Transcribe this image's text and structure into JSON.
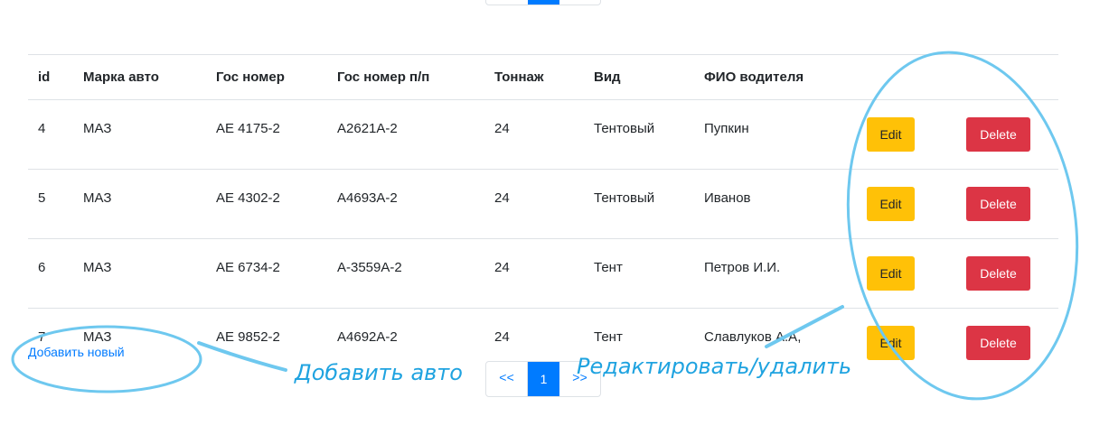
{
  "table": {
    "headers": [
      "id",
      "Марка авто",
      "Гос номер",
      "Гос номер п/п",
      "Тоннаж",
      "Вид",
      "ФИО водителя"
    ],
    "rows": [
      {
        "id": "4",
        "brand": "МАЗ",
        "plate": "АЕ 4175-2",
        "trailer_plate": "А2621А-2",
        "tonnage": "24",
        "type": "Тентовый",
        "driver": "Пупкин"
      },
      {
        "id": "5",
        "brand": "МАЗ",
        "plate": "АЕ 4302-2",
        "trailer_plate": "А4693А-2",
        "tonnage": "24",
        "type": "Тентовый",
        "driver": "Иванов"
      },
      {
        "id": "6",
        "brand": "МАЗ",
        "plate": "АЕ 6734-2",
        "trailer_plate": "А-3559А-2",
        "tonnage": "24",
        "type": "Тент",
        "driver": "Петров И.И."
      },
      {
        "id": "7",
        "brand": "МАЗ",
        "plate": "АЕ 9852-2",
        "trailer_plate": "А4692А-2",
        "tonnage": "24",
        "type": "Тент",
        "driver": "Славлуков А.А,"
      }
    ],
    "edit_label": "Edit",
    "delete_label": "Delete"
  },
  "add_link": "Добавить новый",
  "pagination": {
    "prev": "<<",
    "current": "1",
    "next": ">>"
  },
  "annotations": {
    "add_note": "Добавить авто",
    "edit_note": "Редактировать/удалить"
  },
  "colors": {
    "primary": "#007bff",
    "edit": "#ffc107",
    "delete": "#dc3545",
    "annotation": "#1fa3e0"
  }
}
